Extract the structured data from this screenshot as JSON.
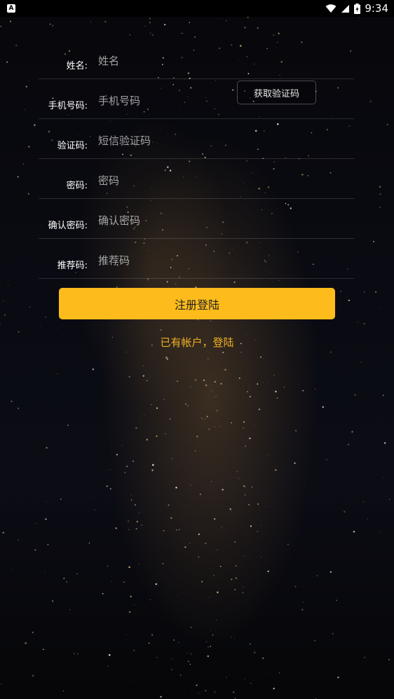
{
  "status_bar": {
    "app_badge": "A",
    "time": "9:34",
    "icons": [
      "wifi-icon",
      "signal-icon",
      "battery-icon"
    ]
  },
  "form": {
    "fields": [
      {
        "label": "姓名:",
        "placeholder": "姓名",
        "value": ""
      },
      {
        "label": "手机号码:",
        "placeholder": "手机号码",
        "value": ""
      },
      {
        "label": "验证码:",
        "placeholder": "短信验证码",
        "value": ""
      },
      {
        "label": "密码:",
        "placeholder": "密码",
        "value": ""
      },
      {
        "label": "确认密码:",
        "placeholder": "确认密码",
        "value": ""
      },
      {
        "label": "推荐码:",
        "placeholder": "推荐码",
        "value": ""
      }
    ],
    "get_code_label": "获取验证码"
  },
  "actions": {
    "register_label": "注册登陆",
    "login_link": "已有帐户，登陆"
  },
  "colors": {
    "accent": "#fdbc1b",
    "link": "#f0b023",
    "background": "#0a0b12"
  }
}
